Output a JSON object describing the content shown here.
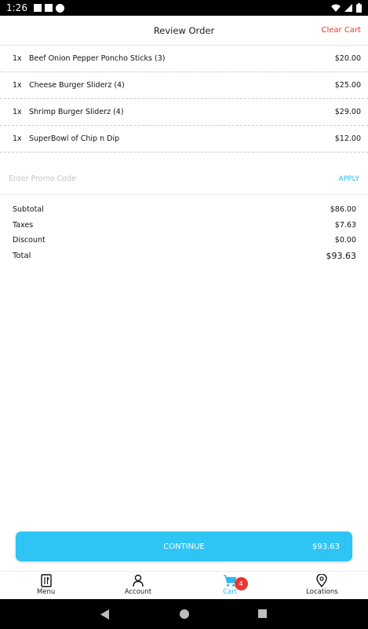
{
  "status": {
    "time": "1:26"
  },
  "header": {
    "title": "Review Order",
    "clear_label": "Clear Cart"
  },
  "items": [
    {
      "qty": "1x",
      "name": "Beef Onion Pepper Poncho Sticks (3)",
      "price": "$20.00"
    },
    {
      "qty": "1x",
      "name": "Cheese Burger Sliderz (4)",
      "price": "$25.00"
    },
    {
      "qty": "1x",
      "name": "Shrimp Burger Sliderz (4)",
      "price": "$29.00"
    },
    {
      "qty": "1x",
      "name": "SuperBowl of Chip n Dip",
      "price": "$12.00"
    }
  ],
  "promo": {
    "placeholder": "Enter Promo Code",
    "value": "",
    "apply_label": "APPLY"
  },
  "summary": {
    "subtotal_label": "Subtotal",
    "subtotal": "$86.00",
    "taxes_label": "Taxes",
    "taxes": "$7.63",
    "discount_label": "Discount",
    "discount": "$0.00",
    "total_label": "Total",
    "total": "$93.63"
  },
  "continue": {
    "label": "CONTINUE",
    "price": "$93.63"
  },
  "nav": {
    "menu": "Menu",
    "account": "Account",
    "cart": "Cart",
    "cart_badge": "4",
    "locations": "Locations"
  },
  "colors": {
    "accent": "#2ec5f5",
    "danger": "#e53935"
  }
}
